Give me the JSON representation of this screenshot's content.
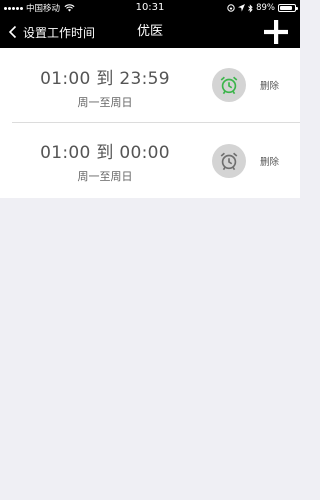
{
  "status_bar": {
    "carrier": "中国移动",
    "time": "10:31",
    "battery_text": "89%",
    "battery_level": 0.89
  },
  "nav": {
    "back_label": "设置工作时间",
    "title": "优医"
  },
  "schedules": [
    {
      "time_range": "01:00 到 23:59",
      "days": "周一至周日",
      "alarm_active": true,
      "alarm_color": "#3bb54a",
      "delete_label": "删除"
    },
    {
      "time_range": "01:00 到 00:00",
      "days": "周一至周日",
      "alarm_active": false,
      "alarm_color": "#6f6f6f",
      "delete_label": "删除"
    }
  ]
}
